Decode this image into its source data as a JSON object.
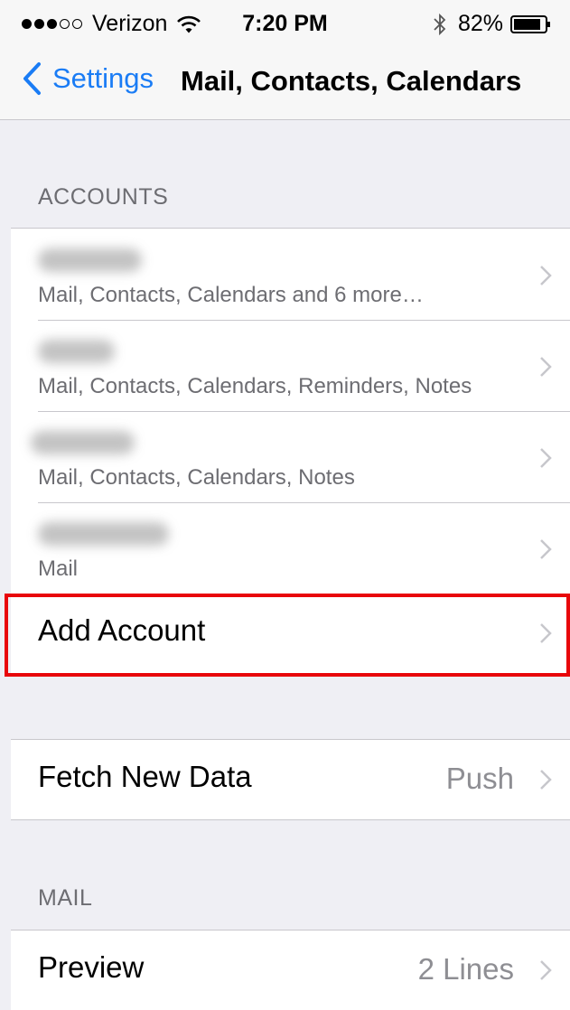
{
  "status_bar": {
    "signal_filled": 3,
    "signal_empty": 2,
    "carrier": "Verizon",
    "time": "7:20 PM",
    "battery_percent": "82%"
  },
  "nav": {
    "back_label": "Settings",
    "title": "Mail, Contacts, Calendars"
  },
  "accounts_section": {
    "header": "ACCOUNTS",
    "accounts": [
      {
        "subtitle": "Mail, Contacts, Calendars and 6 more…"
      },
      {
        "subtitle": "Mail, Contacts, Calendars, Reminders, Notes"
      },
      {
        "subtitle": "Mail, Contacts, Calendars, Notes"
      },
      {
        "subtitle": "Mail"
      }
    ],
    "add_account_label": "Add Account"
  },
  "fetch": {
    "label": "Fetch New Data",
    "value": "Push"
  },
  "mail_section": {
    "header": "MAIL",
    "preview_label": "Preview",
    "preview_value": "2 Lines"
  },
  "colors": {
    "accent": "#1a7cf5",
    "highlight": "#e8060a",
    "background": "#efeff4"
  }
}
